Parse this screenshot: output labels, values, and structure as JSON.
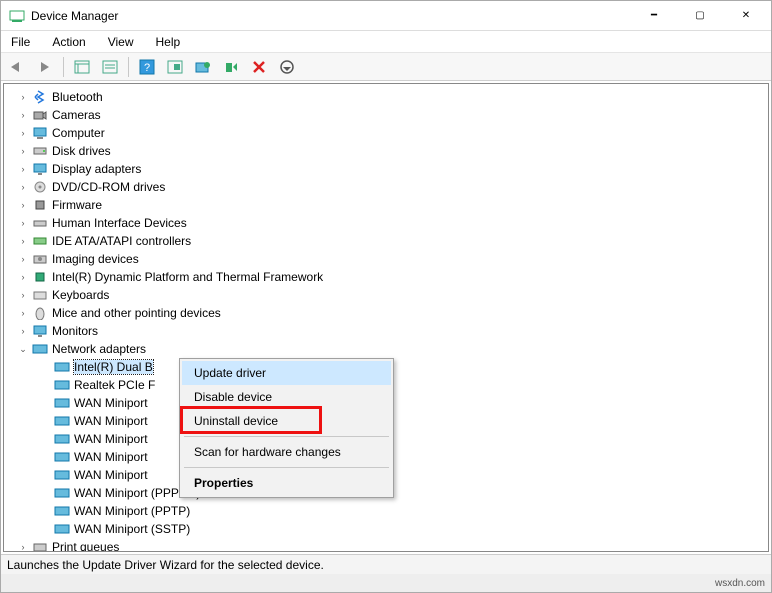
{
  "window": {
    "title": "Device Manager",
    "minimize_glyph": "━",
    "maximize_glyph": "▢",
    "close_glyph": "✕"
  },
  "menubar": {
    "items": [
      "File",
      "Action",
      "View",
      "Help"
    ]
  },
  "tree": {
    "items": [
      {
        "label": "Bluetooth",
        "icon": "bluetooth"
      },
      {
        "label": "Cameras",
        "icon": "camera"
      },
      {
        "label": "Computer",
        "icon": "computer"
      },
      {
        "label": "Disk drives",
        "icon": "disk"
      },
      {
        "label": "Display adapters",
        "icon": "display"
      },
      {
        "label": "DVD/CD-ROM drives",
        "icon": "disc"
      },
      {
        "label": "Firmware",
        "icon": "firmware"
      },
      {
        "label": "Human Interface Devices",
        "icon": "hid"
      },
      {
        "label": "IDE ATA/ATAPI controllers",
        "icon": "ide"
      },
      {
        "label": "Imaging devices",
        "icon": "imaging"
      },
      {
        "label": "Intel(R) Dynamic Platform and Thermal Framework",
        "icon": "chip"
      },
      {
        "label": "Keyboards",
        "icon": "keyboard"
      },
      {
        "label": "Mice and other pointing devices",
        "icon": "mouse"
      },
      {
        "label": "Monitors",
        "icon": "monitor"
      }
    ],
    "expanded": {
      "label": "Network adapters",
      "icon": "net",
      "children": [
        "Intel(R) Dual B",
        "Realtek PCIe F",
        "WAN Miniport",
        "WAN Miniport",
        "WAN Miniport",
        "WAN Miniport",
        "WAN Miniport",
        "WAN Miniport (PPPOE)",
        "WAN Miniport (PPTP)",
        "WAN Miniport (SSTP)"
      ]
    },
    "last": {
      "label": "Print queues",
      "icon": "printer"
    }
  },
  "context_menu": {
    "items": [
      {
        "label": "Update driver",
        "hover": true
      },
      {
        "label": "Disable device"
      },
      {
        "label": "Uninstall device",
        "highlight": true
      },
      {
        "sep": true
      },
      {
        "label": "Scan for hardware changes"
      },
      {
        "sep": true
      },
      {
        "label": "Properties",
        "bold": true
      }
    ]
  },
  "statusbar": {
    "text": "Launches the Update Driver Wizard for the selected device."
  },
  "footer": {
    "watermark": "wsxdn.com"
  }
}
